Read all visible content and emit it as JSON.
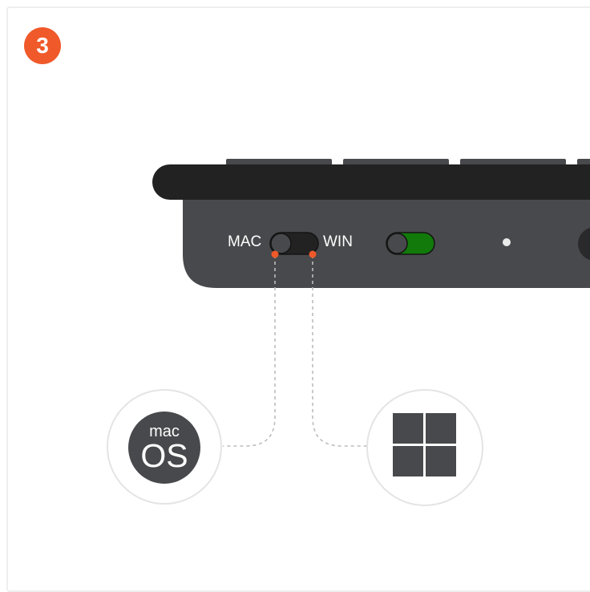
{
  "step_number": "3",
  "switch_labels": {
    "left": "MAC",
    "right": "WIN"
  },
  "os_logos": {
    "mac_top": "mac",
    "mac_bottom": "OS"
  },
  "colors": {
    "accent": "#f0592a",
    "keyboard_body": "#48494c",
    "keyboard_top": "#222222",
    "toggle_on": "#117a0a"
  },
  "icons": [
    "macos-logo-icon",
    "windows-logo-icon"
  ],
  "switches": {
    "os_switch": "mac",
    "power_switch": "on"
  }
}
